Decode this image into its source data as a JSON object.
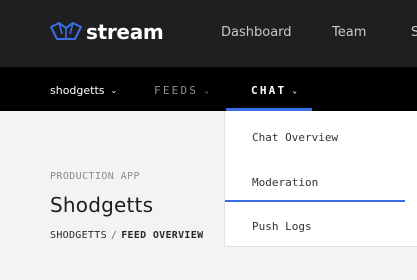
{
  "brand": {
    "name": "stream",
    "logo_color": "#3b6ee3"
  },
  "top_nav": {
    "items": [
      "Dashboard",
      "Team",
      "S"
    ]
  },
  "sub_nav": {
    "app_switcher": "shodgetts",
    "feeds": "FEEDS",
    "chat": "CHAT",
    "active": "CHAT"
  },
  "page": {
    "eyebrow": "PRODUCTION APP",
    "title": "Shodgetts",
    "breadcrumb": {
      "root": "SHODGETTS",
      "separator": "/",
      "current": "FEED OVERVIEW"
    }
  },
  "chat_menu": {
    "items": [
      "Chat Overview",
      "Moderation",
      "Push Logs"
    ],
    "highlighted": "Moderation"
  },
  "colors": {
    "accent": "#3b6ee3",
    "topbar": "#1f1f21",
    "subbar": "#000000"
  }
}
